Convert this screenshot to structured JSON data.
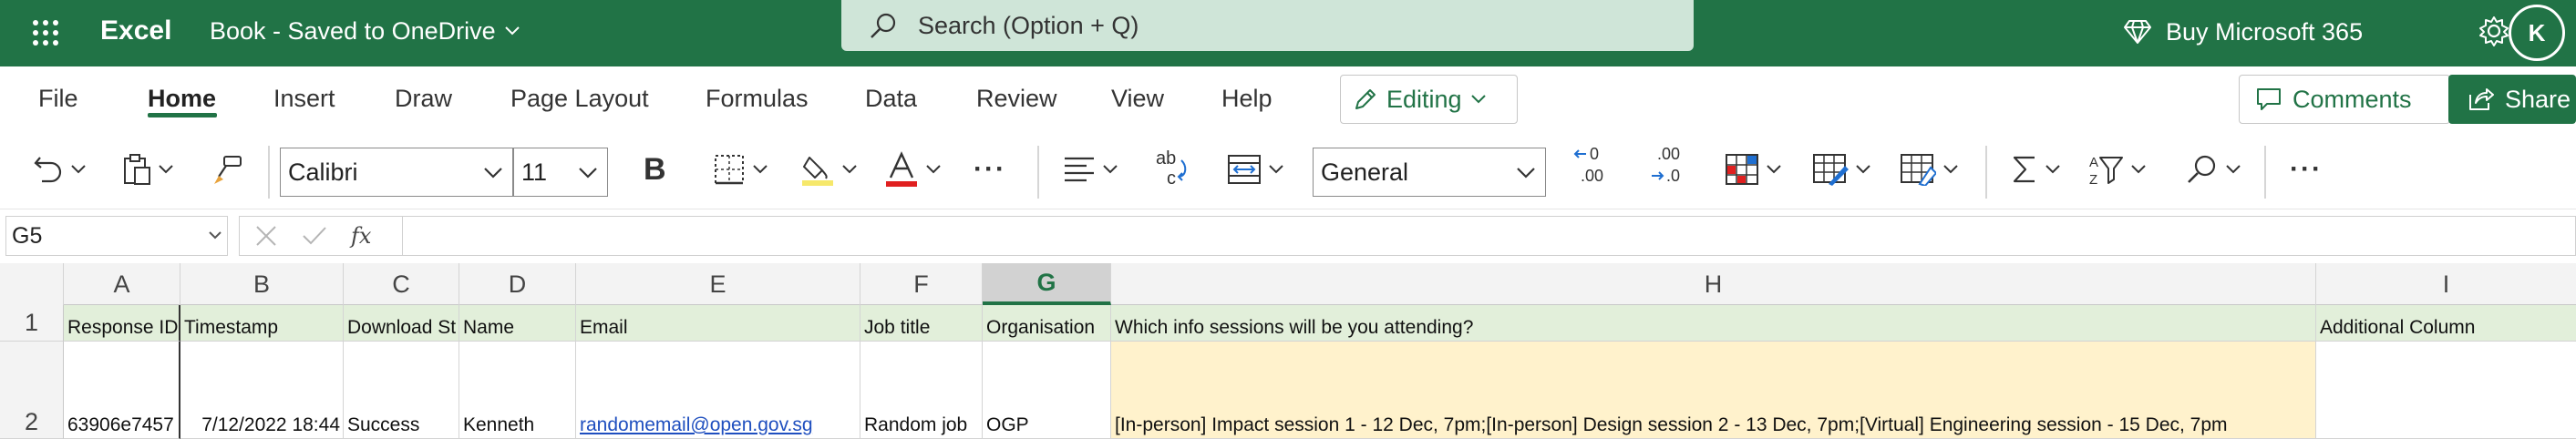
{
  "titlebar": {
    "app_name": "Excel",
    "doc_title": "Book  -  Saved to OneDrive",
    "search_placeholder": "Search (Option + Q)",
    "buy_label": "Buy Microsoft 365",
    "avatar_initial": "K",
    "background": "#217346"
  },
  "ribbon": {
    "tabs": [
      "File",
      "Home",
      "Insert",
      "Draw",
      "Page Layout",
      "Formulas",
      "Data",
      "Review",
      "View",
      "Help"
    ],
    "active_tab": "Home",
    "editing_label": "Editing",
    "comments_label": "Comments",
    "share_label": "Share"
  },
  "toolbar": {
    "font_name": "Calibri",
    "font_size": "11",
    "bold_label": "B",
    "number_format": "General",
    "more_label": "···",
    "icons": [
      "undo-icon",
      "paste-icon",
      "format-painter-icon",
      "bold-icon",
      "borders-icon",
      "fill-color-icon",
      "font-color-icon",
      "align-icon",
      "wrap-text-icon",
      "merge-icon",
      "decrease-decimal-icon",
      "increase-decimal-icon",
      "conditional-format-icon",
      "format-as-table-icon",
      "cell-styles-icon",
      "sum-icon",
      "sort-filter-icon",
      "find-icon"
    ],
    "font_color_swatch": "#e02020",
    "fill_color_swatch": "#f6e86b"
  },
  "formula_bar": {
    "name_box": "G5",
    "fx_label": "fx",
    "formula": ""
  },
  "sheet": {
    "column_headers": [
      "A",
      "B",
      "C",
      "D",
      "E",
      "F",
      "G",
      "H",
      "I"
    ],
    "selected_column": "G",
    "row_numbers": [
      "1",
      "2"
    ],
    "rows": [
      [
        "Response ID",
        "Timestamp",
        "Download St",
        "Name",
        "Email",
        "Job title",
        "Organisation",
        "Which info sessions will be you attending?",
        "Additional Column"
      ],
      [
        "63906e7457",
        "7/12/2022 18:44",
        "Success",
        "Kenneth",
        "randomemail@open.gov.sg",
        "Random job",
        "OGP",
        "[In-person] Impact session 1 - 12 Dec, 7pm;[In-person] Design session 2 - 13 Dec, 7pm;[Virtual] Engineering session - 15 Dec, 7pm",
        ""
      ]
    ],
    "header_row_fill": "#e2efda",
    "highlight_fill": "#fff2cc",
    "link_color": "#1f4fbf"
  }
}
